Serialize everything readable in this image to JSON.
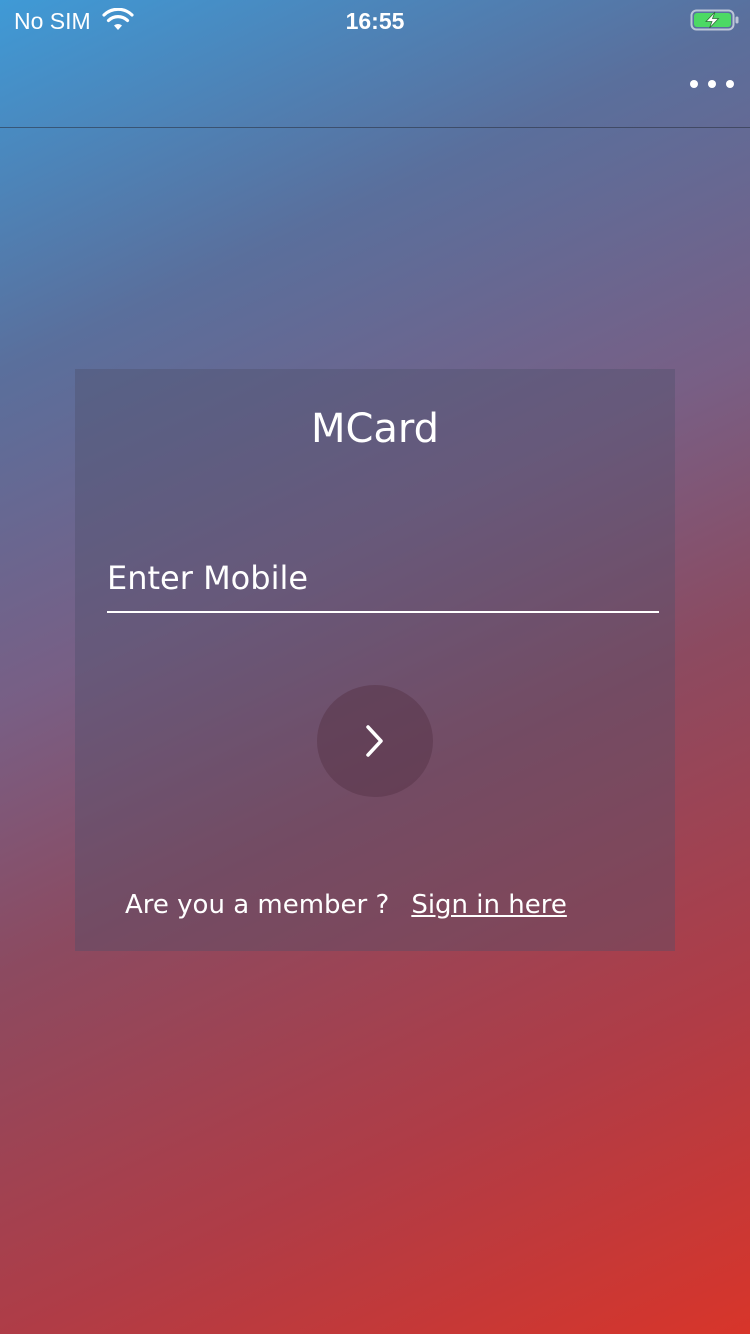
{
  "status_bar": {
    "carrier": "No SIM",
    "time": "16:55",
    "wifi_icon": "wifi-icon",
    "battery_icon": "battery-charging-icon"
  },
  "nav": {
    "more_icon": "more-horizontal-icon"
  },
  "login_card": {
    "title": "MCard",
    "mobile_placeholder": "Enter Mobile",
    "mobile_value": "",
    "next_icon": "chevron-right-icon",
    "member_prompt": "Are you a member ?",
    "signin_link": "Sign in here"
  },
  "colors": {
    "gradient_start": "#3f9ad6",
    "gradient_end": "#d8352a",
    "text": "#ffffff",
    "battery_fill": "#4cd964"
  }
}
